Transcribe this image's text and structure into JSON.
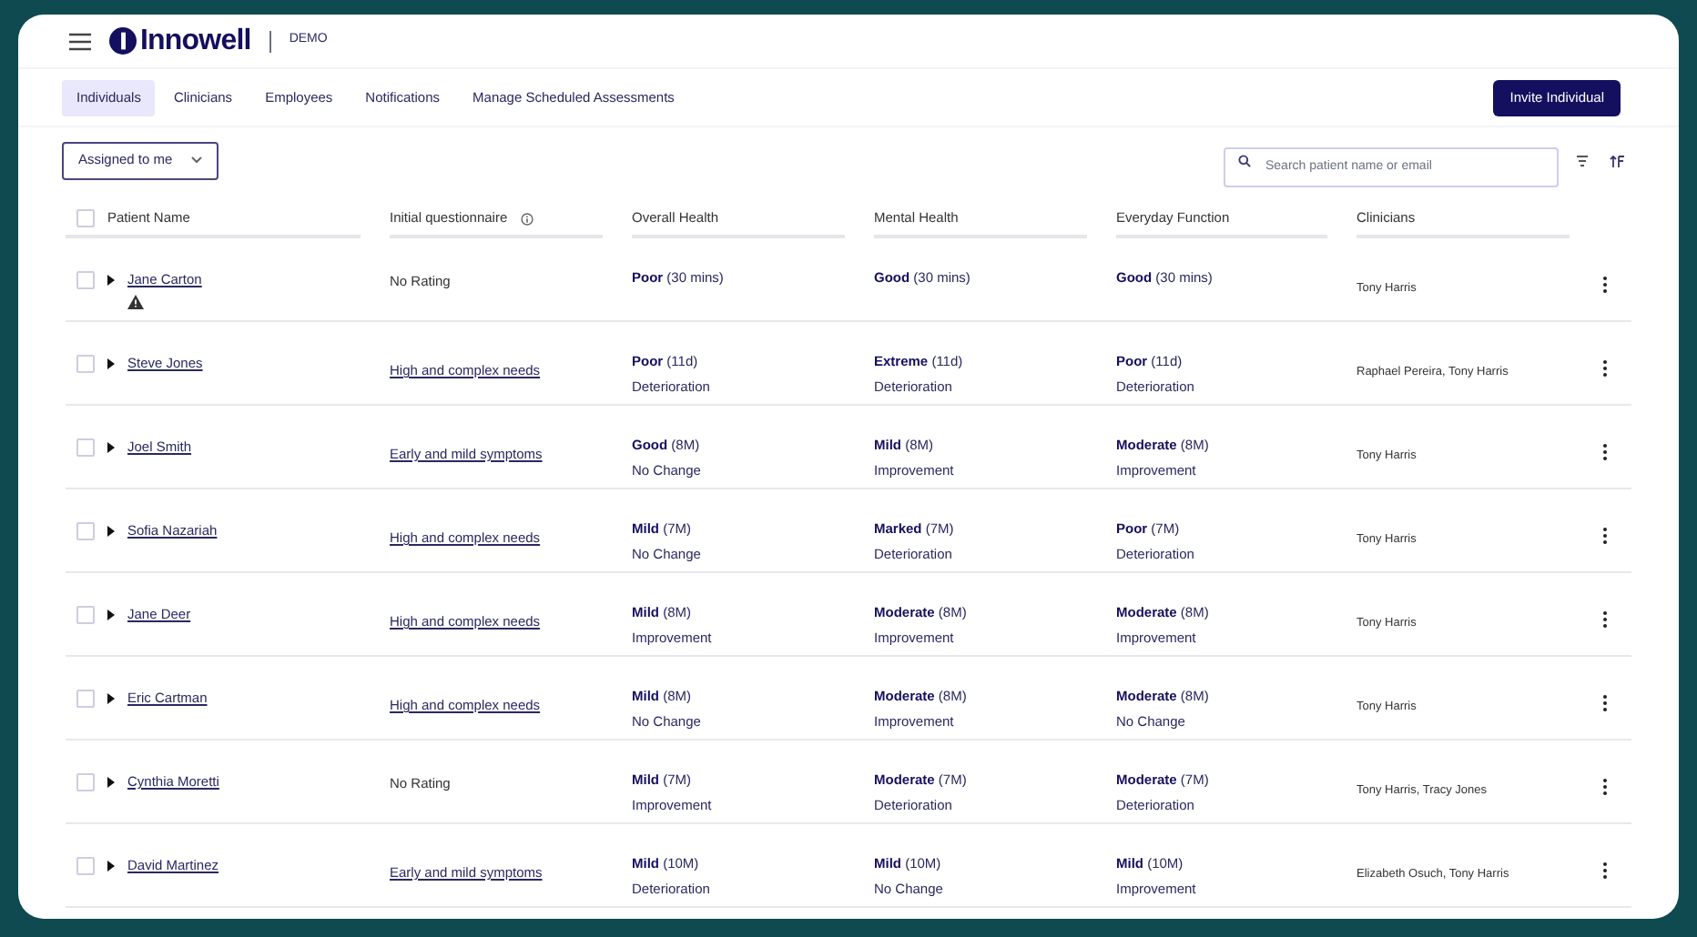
{
  "header": {
    "brand": "Innowell",
    "env": "DEMO"
  },
  "tabs": [
    {
      "label": "Individuals",
      "selected": true
    },
    {
      "label": "Clinicians",
      "selected": false
    },
    {
      "label": "Employees",
      "selected": false
    },
    {
      "label": "Notifications",
      "selected": false
    },
    {
      "label": "Manage Scheduled Assessments",
      "selected": false
    }
  ],
  "invite_button": "Invite Individual",
  "filter": {
    "value": "Assigned to me"
  },
  "search": {
    "placeholder": "Search patient name or email"
  },
  "table": {
    "select_all_checked": false,
    "columns": [
      "Patient Name",
      "Initial questionnaire",
      "Overall Health",
      "Mental Health",
      "Everyday Function",
      "Clinicians"
    ],
    "rows": [
      {
        "checked": false,
        "name": "Jane Carton",
        "alert": true,
        "questionnaire": {
          "kind": "text",
          "text": "No Rating"
        },
        "scores": [
          {
            "rating": "Poor",
            "period": "(30 mins)"
          },
          {
            "rating": "Good",
            "period": "(30 mins)"
          },
          {
            "rating": "Good",
            "period": "(30 mins)"
          }
        ],
        "clinicians": "Tony Harris"
      },
      {
        "checked": false,
        "name": "Steve Jones",
        "alert": false,
        "questionnaire": {
          "kind": "link",
          "text": "High and complex needs"
        },
        "scores": [
          {
            "rating": "Poor",
            "period": "(11d)",
            "trend": "Deterioration"
          },
          {
            "rating": "Extreme",
            "period": "(11d)",
            "trend": "Deterioration"
          },
          {
            "rating": "Poor",
            "period": "(11d)",
            "trend": "Deterioration"
          }
        ],
        "clinicians": "Raphael Pereira, Tony Harris"
      },
      {
        "checked": false,
        "name": "Joel Smith",
        "alert": false,
        "questionnaire": {
          "kind": "link",
          "text": "Early and mild symptoms"
        },
        "scores": [
          {
            "rating": "Good",
            "period": "(8M)",
            "trend": "No Change"
          },
          {
            "rating": "Mild",
            "period": "(8M)",
            "trend": "Improvement"
          },
          {
            "rating": "Moderate",
            "period": "(8M)",
            "trend": "Improvement"
          }
        ],
        "clinicians": "Tony Harris"
      },
      {
        "checked": false,
        "name": "Sofia Nazariah",
        "alert": false,
        "questionnaire": {
          "kind": "link",
          "text": "High and complex needs"
        },
        "scores": [
          {
            "rating": "Mild",
            "period": "(7M)",
            "trend": "No Change"
          },
          {
            "rating": "Marked",
            "period": "(7M)",
            "trend": "Deterioration"
          },
          {
            "rating": "Poor",
            "period": "(7M)",
            "trend": "Deterioration"
          }
        ],
        "clinicians": "Tony Harris"
      },
      {
        "checked": false,
        "name": "Jane Deer",
        "alert": false,
        "questionnaire": {
          "kind": "link",
          "text": "High and complex needs"
        },
        "scores": [
          {
            "rating": "Mild",
            "period": "(8M)",
            "trend": "Improvement"
          },
          {
            "rating": "Moderate",
            "period": "(8M)",
            "trend": "Improvement"
          },
          {
            "rating": "Moderate",
            "period": "(8M)",
            "trend": "Improvement"
          }
        ],
        "clinicians": "Tony Harris"
      },
      {
        "checked": false,
        "name": "Eric Cartman",
        "alert": false,
        "questionnaire": {
          "kind": "link",
          "text": "High and complex needs"
        },
        "scores": [
          {
            "rating": "Mild",
            "period": "(8M)",
            "trend": "No Change"
          },
          {
            "rating": "Moderate",
            "period": "(8M)",
            "trend": "Improvement"
          },
          {
            "rating": "Moderate",
            "period": "(8M)",
            "trend": "No Change"
          }
        ],
        "clinicians": "Tony Harris"
      },
      {
        "checked": false,
        "name": "Cynthia Moretti",
        "alert": false,
        "questionnaire": {
          "kind": "text",
          "text": "No Rating"
        },
        "scores": [
          {
            "rating": "Mild",
            "period": "(7M)",
            "trend": "Improvement"
          },
          {
            "rating": "Moderate",
            "period": "(7M)",
            "trend": "Deterioration"
          },
          {
            "rating": "Moderate",
            "period": "(7M)",
            "trend": "Deterioration"
          }
        ],
        "clinicians": "Tony Harris, Tracy Jones"
      },
      {
        "checked": false,
        "name": "David Martinez",
        "alert": false,
        "questionnaire": {
          "kind": "link",
          "text": "Early and mild symptoms"
        },
        "scores": [
          {
            "rating": "Mild",
            "period": "(10M)",
            "trend": "Deterioration"
          },
          {
            "rating": "Mild",
            "period": "(10M)",
            "trend": "No Change"
          },
          {
            "rating": "Mild",
            "period": "(10M)",
            "trend": "Improvement"
          }
        ],
        "clinicians": "Elizabeth Osuch, Tony Harris"
      }
    ]
  }
}
